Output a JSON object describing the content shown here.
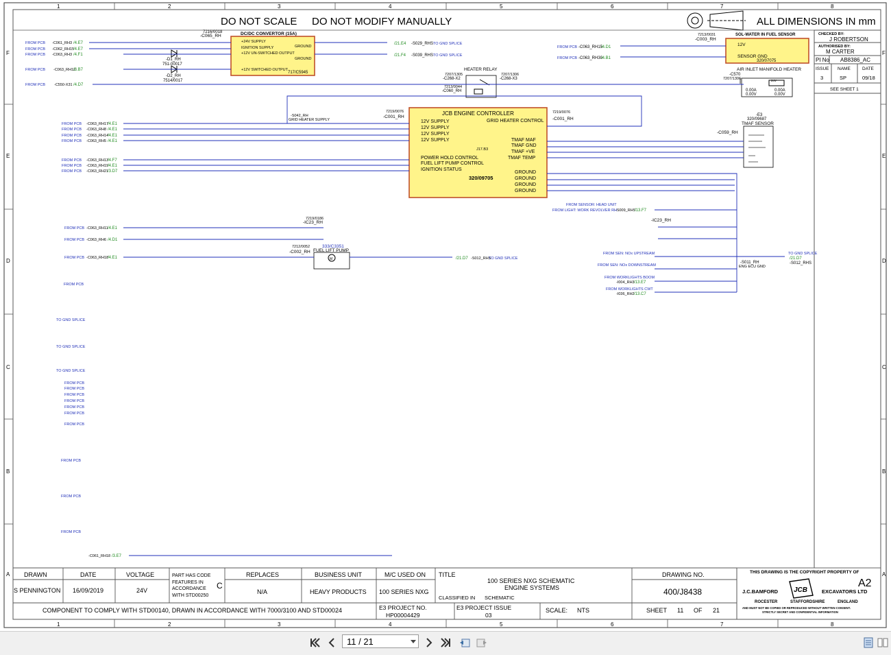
{
  "grid": {
    "columns": [
      "1",
      "2",
      "3",
      "4",
      "5",
      "6",
      "7",
      "8"
    ],
    "rows": [
      "F",
      "E",
      "D",
      "C",
      "B",
      "A"
    ]
  },
  "header": {
    "scale_note": "DO NOT SCALE",
    "modify_note": "DO NOT MODIFY MANUALLY",
    "dimensions_note": "ALL DIMENSIONS IN mm"
  },
  "components": {
    "dcdc": {
      "part_ref": "7216/0018",
      "ref": "-C065_RH",
      "title": "DC/DC CONVERTOR (15A)",
      "part_no": "717/C5945",
      "pins": [
        "+24V SUPPLY",
        "IGNITION SUPPLY",
        "+12V UN-SWITCHED OUTPUT",
        "+12V SWITCHED OUTPUT"
      ],
      "grounds": [
        "GROUND",
        "GROUND"
      ]
    },
    "d1": {
      "ref": "-D1_RH",
      "part": "751-00017"
    },
    "d2": {
      "ref": "-D2_RH",
      "part": "7514/0017"
    },
    "relay": {
      "title": "HEATER RELAY",
      "ref_a": "7207/1305",
      "conn_a": "-C268-X2",
      "ref_b": "7207/1306",
      "conn_b": "-C268-X3",
      "ref_c": "7213/0044",
      "conn_c": "-C060_RH"
    },
    "ecu": {
      "part_ref": "7219/0076",
      "ref": "-C001_RH",
      "part_ref_b": "7219/0076",
      "ref_b": "-C001_RH",
      "title": "JCB ENGINE CONTROLLER",
      "part_no": "320/09705",
      "code": "J17.B3",
      "left_pins": [
        "12V SUPPLY",
        "12V SUPPLY",
        "12V SUPPLY",
        "12V SUPPLY",
        "POWER HOLD CONTROL",
        "FUEL LIFT PUMP CONTROL",
        "IGNITION STATUS"
      ],
      "right_pins": [
        "GRID HEATER CONTROL",
        "TMAF MAF",
        "TMAF GND",
        "TMAF +VE",
        "TMAF TEMP",
        "GROUND",
        "GROUND",
        "GROUND",
        "GROUND"
      ]
    },
    "sol_water": {
      "part_ref": "7213/0031",
      "ref": "-C003_RH",
      "title": "SOL-WATER IN FUEL SENSOR",
      "pins": [
        "12V",
        "SENSOR GND"
      ],
      "part_no": "320/07075"
    },
    "air_heater": {
      "title": "AIR INLET MANIFOLD HEATER",
      "ref": "-C570",
      "part_ref": "7207/1306",
      "values": [
        "0.00A",
        "0.00V",
        "0.00A",
        "0.00V"
      ],
      "voltage": "24V"
    },
    "tmaf": {
      "ref": "-E3",
      "part": "320/09687",
      "title": "TMAF SENSOR",
      "conn": "-C059_RH"
    },
    "grid_heater_supply": {
      "ref": "-S042_RH",
      "label": "GRID HEATER SUPPLY"
    },
    "ic23": {
      "part_ref": "7219/0186",
      "ref": "-IC23_RH"
    },
    "ic23_right": {
      "ref": "-IC23_RH"
    },
    "fuel_pump": {
      "part_ref": "7212/0052",
      "ref": "-C002_RH",
      "part_no": "333/C3351",
      "title": "FUEL LIFT PUMP"
    },
    "gnd_splice": {
      "ref": "-S011_RH",
      "label": "ENG ECU GND",
      "to_ref": "-S012_RHS",
      "to_label": "TO GND SPLICE",
      "to_xref": "/21.D7"
    }
  },
  "left_signals": [
    {
      "src": "FROM PCB",
      "ref": "-C061_RH3",
      "xref": "/4.E7"
    },
    {
      "src": "FROM PCB",
      "ref": "-C062_RH15",
      "xref": "/4.E7"
    },
    {
      "src": "FROM PCB",
      "ref": "-C063_RH3",
      "xref": "/4.F1"
    },
    {
      "src": "FROM PCB",
      "ref": "-C063_RH12",
      "xref": "/3.B7"
    },
    {
      "src": "FROM PCB",
      "ref": "-C550-X31",
      "xref": "/4.D7"
    },
    {
      "src": "FROM PCB",
      "ref": "-C063_RH17",
      "xref": "/4.E1"
    },
    {
      "src": "FROM PCB",
      "ref": "-C063_RH8",
      "xref": "/4.E1"
    },
    {
      "src": "FROM PCB",
      "ref": "-C063_RH14",
      "xref": "/4.E1"
    },
    {
      "src": "FROM PCB",
      "ref": "-C063_RH5",
      "xref": "/4.E1"
    },
    {
      "src": "FROM PCB",
      "ref": "-C063_RH13",
      "xref": "/4.F7"
    },
    {
      "src": "FROM PCB",
      "ref": "-C063_RH19",
      "xref": "/4.E1"
    },
    {
      "src": "FROM PCB",
      "ref": "-C063_RH21",
      "xref": "/3.D7"
    },
    {
      "src": "FROM PCB",
      "ref": "-C063_RH11",
      "xref": "/4.E1"
    },
    {
      "src": "FROM PCB",
      "ref": "-C063_RH6",
      "xref": "/4.D1"
    },
    {
      "src": "FROM PCB",
      "ref": "-C063_RH18",
      "xref": "/4.E1"
    }
  ],
  "dcdc_outputs": [
    {
      "xref": "/21.E4",
      "ref": "-S029_RHS",
      "dest": "TO GND SPLICE"
    },
    {
      "xref": "/21.F4",
      "ref": "-S039_RHS",
      "dest": "TO GND SPLICE"
    }
  ],
  "right_signals": [
    {
      "src": "FROM PCB",
      "ref": "-C063_RH15",
      "xref": "/4.D1"
    },
    {
      "src": "FROM PCB",
      "ref": "-C063_RH30",
      "xref": "/4.B1"
    }
  ],
  "sensor_notes": [
    {
      "label": "FROM SENSOR: HEAD UNIT"
    },
    {
      "label": "FROM LIGHT: WORK REVOLVER RH",
      "ref": "-S009_RHS",
      "xref": "/13.F7"
    },
    {
      "label": "FROM SEN: NOx UPSTREAM"
    },
    {
      "label": "FROM SEN: NOx DOWNSTREAM"
    },
    {
      "label": "FROM WORKLIGHTS BOOM",
      "ref": "-I004_RH3",
      "xref": "/13.E7"
    },
    {
      "label": "FROM WORKLIGHTS CWT",
      "ref": "-I036_RH2",
      "xref": "/13.C7"
    }
  ],
  "fuel_pump_out": {
    "xref": "/21.D7",
    "ref": "-S012_RHS",
    "dest": "TO GND SPLICE"
  },
  "bottom_wire": {
    "ref": "-C061_RH18",
    "xref": "/3.E7"
  },
  "stray_labels": {
    "from_pcb": "FROM PCB",
    "to_gnd_splice": "TO GND SPLICE"
  },
  "title_block": {
    "h_drawn": "DRAWN",
    "drawn": "S PENNINGTON",
    "h_date": "DATE",
    "date": "16/09/2019",
    "h_voltage": "VOLTAGE",
    "voltage": "24V",
    "part_code_note": [
      "PART HAS CODE",
      "FEATURES IN",
      "ACCORDANCE",
      "WITH STD00250"
    ],
    "part_code_letter": "C",
    "h_replaces": "REPLACES",
    "replaces": "N/A",
    "h_business": "BUSINESS UNIT",
    "business": "HEAVY PRODUCTS",
    "h_mc": "M/C USED ON",
    "mc": "100 SERIES NXG",
    "h_title": "TITLE",
    "title_1": "100 SERIES NXG SCHEMATIC",
    "title_2": "ENGINE SYSTEMS",
    "classified_label": "CLASSIFIED IN",
    "classified": "SCHEMATIC",
    "h_drawing_no": "DRAWING NO.",
    "drawing_no": "400/J8438",
    "size": "A2",
    "compliance": "COMPONENT TO COMPLY WITH STD00140, DRAWN IN ACCORDANCE WITH 7000/3100 AND STD00024",
    "h_e3_project": "E3 PROJECT NO.",
    "e3_project": "HP00004429",
    "h_e3_issue": "E3 PROJECT ISSUE",
    "e3_issue": "03",
    "scale_label": "SCALE:",
    "scale": "NTS",
    "sheet_label": "SHEET",
    "sheet": "11",
    "of_label": "OF",
    "sheets": "21",
    "copyright": "THIS DRAWING IS THE COPYRIGHT PROPERTY OF",
    "company_left": "J.C.BAMFORD",
    "company_right": "EXCAVATORS LTD",
    "address": [
      "ROCESTER",
      "STAFFORDSHIRE",
      "ENGLAND"
    ],
    "fine_print_1": "AND MUST NOT BE COPIED OR REPRODUCED WITHOUT WRITTEN CONSENT.",
    "fine_print_2": "STRICTLY SECRET AND CONFIDENTIAL INFORMATION",
    "logo_text": "JCB"
  },
  "approval_block": {
    "checked_label": "CHECKED BY:",
    "checked": "J ROBERTSON",
    "authorised_label": "AUTHORISED BY:",
    "authorised": "M CARTER",
    "pi_label": "PI No",
    "pi": "AB8386_AC",
    "h_issue": "ISSUE",
    "h_name": "NAME",
    "h_date": "DATE",
    "issue": "3",
    "name": "SP",
    "date": "09/18",
    "see_sheet": "SEE SHEET 1"
  },
  "viewer": {
    "page_value": "11 / 21"
  },
  "colors": {
    "wire": "#1f2fb8",
    "component_fill": "#fff48a",
    "component_border": "#c0502a",
    "xref": "#1e8a1e",
    "frame": "#444444"
  }
}
